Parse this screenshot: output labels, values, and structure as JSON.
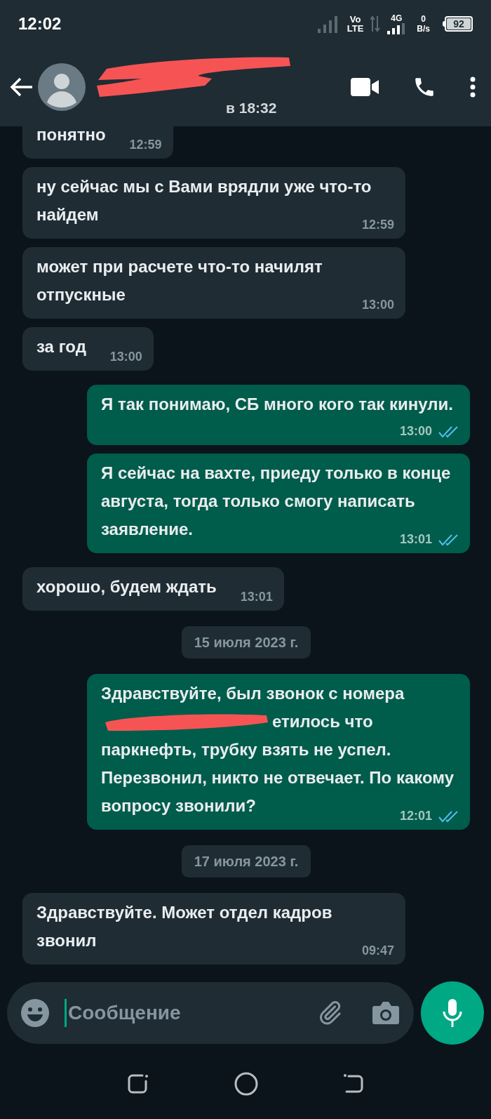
{
  "status_bar": {
    "time": "12:02",
    "volte_top": "Vo",
    "volte_bottom": "LTE",
    "network": "4G",
    "speed_value": "0",
    "speed_unit": "B/s",
    "battery": "92"
  },
  "header": {
    "last_seen": "в 18:32"
  },
  "messages": [
    {
      "kind": "in",
      "text": "понятно",
      "time": "12:59"
    },
    {
      "kind": "in",
      "text": "ну сейчас мы с Вами врядли уже что-то найдем",
      "time": "12:59"
    },
    {
      "kind": "in",
      "text": "может при расчете что-то начилят отпускные",
      "time": "13:00"
    },
    {
      "kind": "in",
      "text": "за год",
      "time": "13:00"
    },
    {
      "kind": "out",
      "text": "Я так понимаю, СБ много кого так кинули.",
      "time": "13:00",
      "read": true
    },
    {
      "kind": "out",
      "text": "Я сейчас на вахте, приеду только в конце августа, тогда только смогу написать заявление.",
      "time": "13:01",
      "read": true
    },
    {
      "kind": "in",
      "text": "хорошо, будем ждать",
      "time": "13:01"
    },
    {
      "kind": "date",
      "text": "15 июля 2023 г."
    },
    {
      "kind": "out",
      "text": "Здравствуйте, был звонок с номера",
      "redacted": true,
      "text_after_redaction": "етилось что",
      "text_continued": "паркнефть, трубку взять не успел. Перезвонил, никто не отвечает. По какому вопросу звонили?",
      "time": "12:01",
      "read": true
    },
    {
      "kind": "date",
      "text": "17 июля 2023 г."
    },
    {
      "kind": "in",
      "text": "Здравствуйте. Может отдел кадров звонил",
      "time": "09:47"
    }
  ],
  "composer": {
    "placeholder": "Сообщение"
  }
}
